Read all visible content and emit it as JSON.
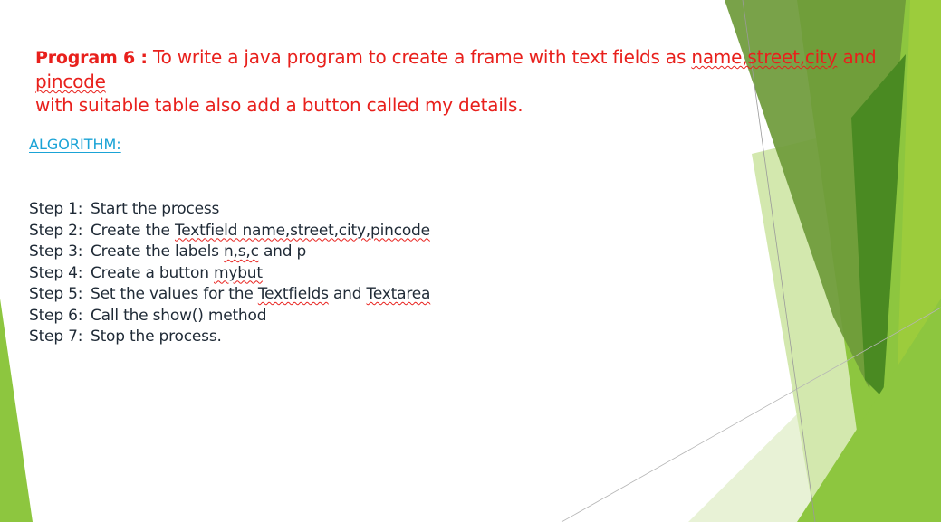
{
  "program": {
    "label": "Program 6 :",
    "text_before": " To write a java program to create a frame with text fields as ",
    "text_flagged": "name,street,city",
    "text_middle": " and ",
    "text_flagged2": "pincode",
    "line2": "with suitable table also add a button called my details.",
    "bullet": "."
  },
  "algorithm": {
    "heading": "ALGORITHM:"
  },
  "steps": [
    {
      "label": "Step 1:",
      "text": "Start the process"
    },
    {
      "label": "Step 2:",
      "text_before": "Create the ",
      "flagged": "Textfield name,street,city,pincode",
      "text_after": ""
    },
    {
      "label": "Step 3:",
      "text_before": "Create the labels ",
      "flagged": "n,s,c",
      "text_after": " and p"
    },
    {
      "label": "Step 4:",
      "text_before": "Create a button ",
      "flagged": "mybut",
      "text_after": ""
    },
    {
      "label": "Step 5:",
      "text_before": "Set the values for the ",
      "flagged": "Textfields",
      "text_middle": " and ",
      "flagged2": "Textarea"
    },
    {
      "label": "Step 6:",
      "text": "Call the show() method"
    },
    {
      "label": "Step 7:",
      "text": "Stop the process."
    }
  ],
  "theme": {
    "title_color": "#e8201c",
    "heading_color": "#1aa3d6",
    "body_color": "#1f2a36",
    "accent_greens": [
      "#8dc63f",
      "#5a9a2a",
      "#c9e29a",
      "#e6f1d3",
      "#3f7f1f"
    ]
  }
}
